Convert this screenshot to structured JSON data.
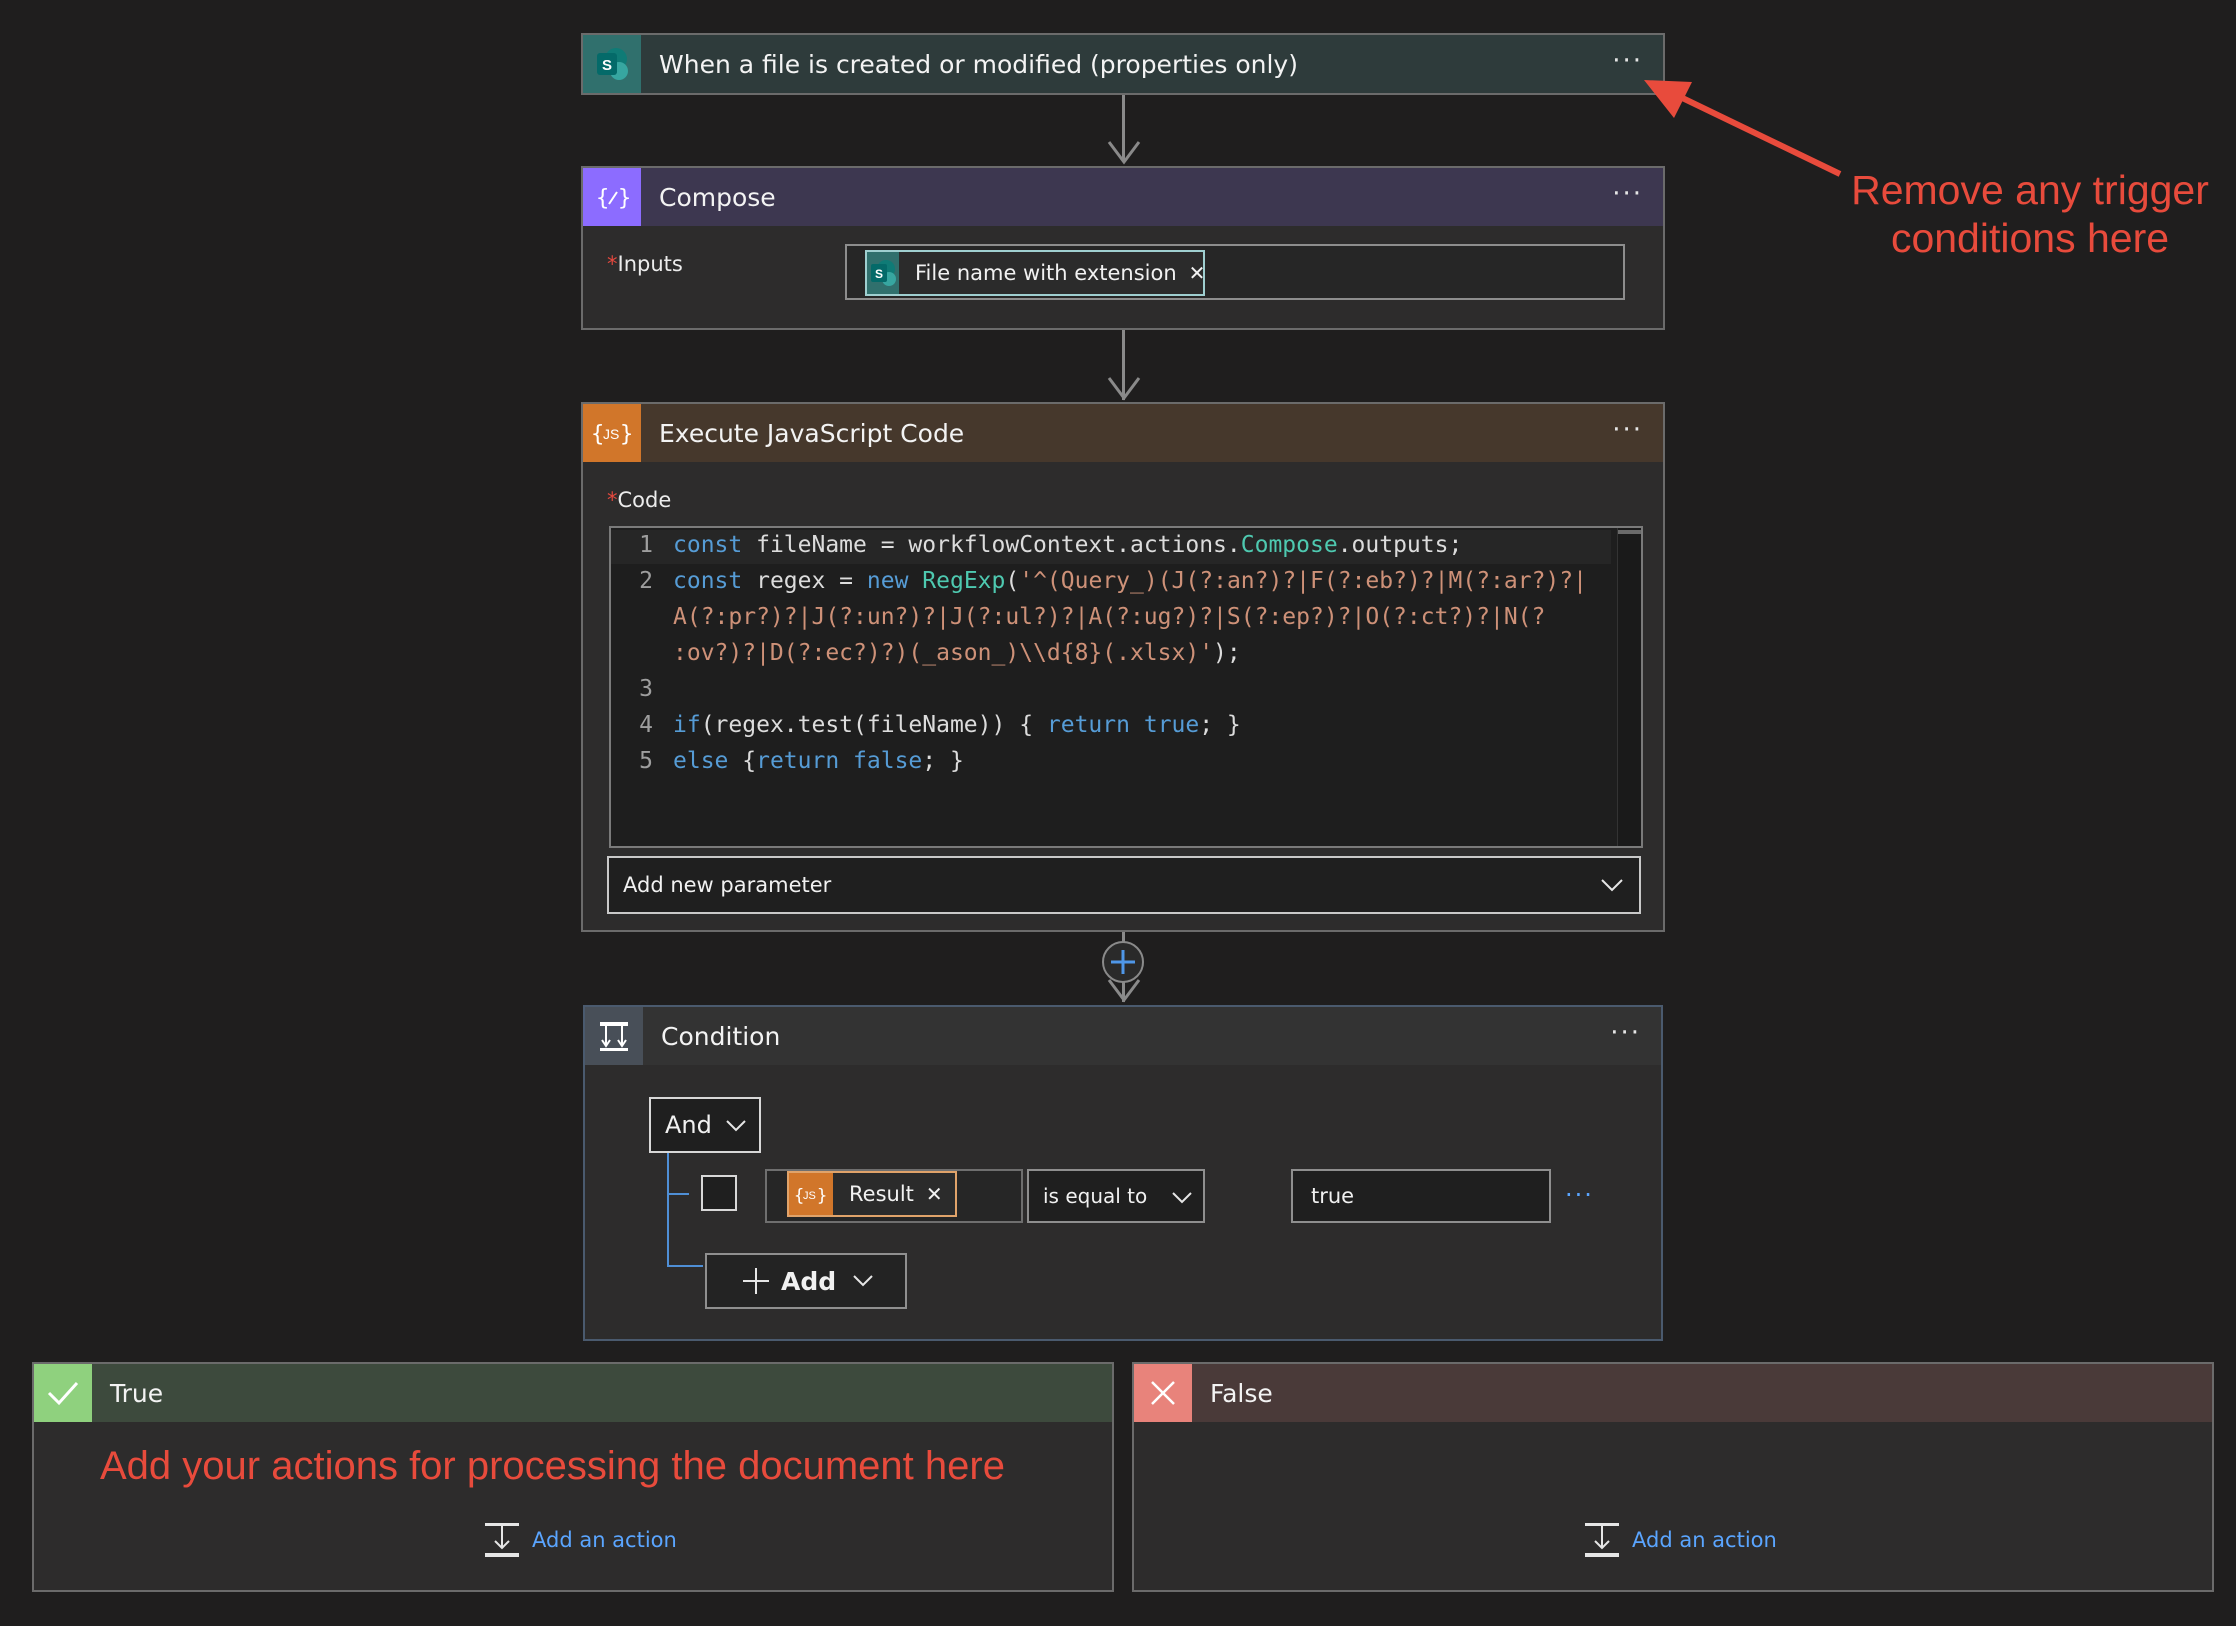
{
  "trigger": {
    "title": "When a file is created or modified (properties only)",
    "menu": "···"
  },
  "annotation_trigger": {
    "line1": "Remove any trigger",
    "line2": "conditions here"
  },
  "compose": {
    "title": "Compose",
    "menu": "···",
    "inputs_label": "Inputs",
    "required_mark": "*",
    "token_label": "File name with extension",
    "token_remove": "✕"
  },
  "js": {
    "title": "Execute JavaScript Code",
    "menu": "···",
    "code_label": "Code",
    "required_mark": "*",
    "add_param": "Add new parameter",
    "lines": {
      "n1": "1",
      "n2": "2",
      "n3": "3",
      "n4": "4",
      "n5": "5",
      "l1a": "const",
      "l1b": " fileName = workflowContext.actions.",
      "l1c": "Compose",
      "l1d": ".outputs;",
      "l2a": "const",
      "l2b": " regex = ",
      "l2c": "new",
      "l2d": " ",
      "l2e": "RegExp",
      "l2f": "(",
      "l2g": "'^(Query_)(J(?:an?)?|F(?:eb?)?|M(?:ar?)?|",
      "l2h": "A(?:pr?)?|J(?:un?)?|J(?:ul?)?|A(?:ug?)?|S(?:ep?)?|O(?:ct?)?|N(?",
      "l2i": ":ov?)?|D(?:ec?)?)(_ason_)\\\\d{8}(.xlsx)'",
      "l2j": ");",
      "l4a": "if",
      "l4b": "(regex.test(fileName)) { ",
      "l4c": "return",
      "l4d": " ",
      "l4e": "true",
      "l4f": "; }",
      "l5a": "else",
      "l5b": " {",
      "l5c": "return",
      "l5d": " ",
      "l5e": "false",
      "l5f": "; }"
    }
  },
  "condition": {
    "title": "Condition",
    "menu": "···",
    "group_op": "And",
    "token_label": "Result",
    "token_remove": "✕",
    "operator": "is equal to",
    "value": "true",
    "row_menu": "···",
    "add_label": "Add"
  },
  "true_branch": {
    "title": "True",
    "annotation": "Add your actions for processing the document here",
    "add_action": "Add an action"
  },
  "false_branch": {
    "title": "False",
    "add_action": "Add an action"
  },
  "colors": {
    "sharepoint": "#036c70",
    "compose": "#8c6cff",
    "js": "#d1762a",
    "condition": "#484f58",
    "true": "#8fd17e",
    "false": "#e8837b",
    "annotation": "#e84b3c"
  }
}
